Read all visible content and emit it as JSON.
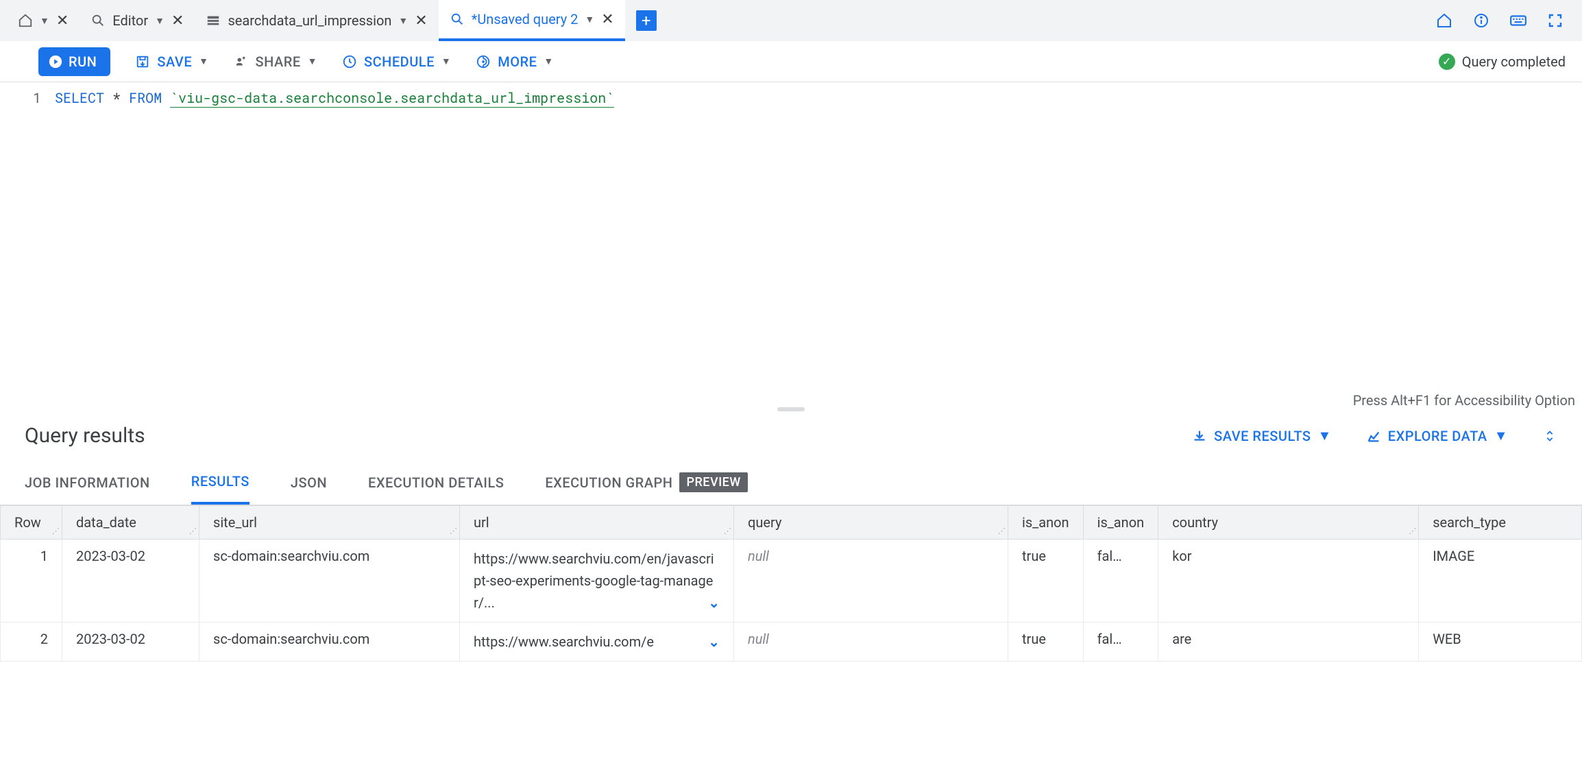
{
  "tabs": [
    {
      "label": "",
      "icon": "home"
    },
    {
      "label": "Editor",
      "icon": "query"
    },
    {
      "label": "searchdata_url_impression",
      "icon": "table"
    },
    {
      "label": "*Unsaved query 2",
      "icon": "query",
      "active": true
    }
  ],
  "toolbar": {
    "run": "RUN",
    "save": "SAVE",
    "share": "SHARE",
    "schedule": "SCHEDULE",
    "more": "MORE"
  },
  "status": "Query completed",
  "editor": {
    "line_number": "1",
    "kw_select": "SELECT",
    "star": "*",
    "kw_from": "FROM",
    "table_ref": "`viu-gsc-data.searchconsole.searchdata_url_impression`",
    "accessibility": "Press Alt+F1 for Accessibility Option"
  },
  "results": {
    "title": "Query results",
    "save_results": "SAVE RESULTS",
    "explore_data": "EXPLORE DATA",
    "tabs": {
      "job_info": "JOB INFORMATION",
      "results": "RESULTS",
      "json": "JSON",
      "exec_details": "EXECUTION DETAILS",
      "exec_graph": "EXECUTION GRAPH",
      "preview_badge": "PREVIEW"
    },
    "columns": [
      "Row",
      "data_date",
      "site_url",
      "url",
      "query",
      "is_anon",
      "is_anon",
      "country",
      "search_type"
    ],
    "rows": [
      {
        "n": "1",
        "data_date": "2023-03-02",
        "site_url": "sc-domain:searchviu.com",
        "url": "https://www.searchviu.com/en/javascript-seo-experiments-google-tag-manager/...",
        "query": "null",
        "is_anon1": "true",
        "is_anon2": "fal…",
        "country": "kor",
        "search_type": "IMAGE"
      },
      {
        "n": "2",
        "data_date": "2023-03-02",
        "site_url": "sc-domain:searchviu.com",
        "url": "https://www.searchviu.com/e",
        "query": "null",
        "is_anon1": "true",
        "is_anon2": "fal…",
        "country": "are",
        "search_type": "WEB"
      }
    ]
  }
}
